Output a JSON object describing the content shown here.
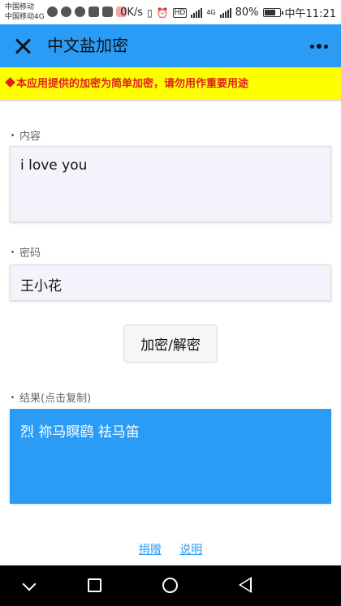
{
  "status_bar": {
    "carrier_1": "中国移动",
    "carrier_2": "中国移动4G",
    "speed": "0K/s",
    "hd_badge": "HD",
    "network_badge": "4G",
    "battery_percent": "80%",
    "battery_level": 0.8,
    "time": "中午11:21",
    "icons": [
      "wechat-icon",
      "app-icon",
      "chat-icon",
      "shield-icon",
      "calendar-icon",
      "notification-icon",
      "vibrate-icon",
      "alarm-icon",
      "signal-icon",
      "battery-icon"
    ]
  },
  "app_bar": {
    "title": "中文盐加密",
    "close_icon": "close-icon",
    "more_icon": "more-icon",
    "color": "#2b9cf5"
  },
  "warning": {
    "text": "本应用提供的加密为简单加密，请勿用作重要用途",
    "icon": "diamond-icon",
    "background": "#ffff00",
    "color": "#e02020"
  },
  "form": {
    "content_label": "内容",
    "content_value": "i love you",
    "password_label": "密码",
    "password_value": "王小花",
    "action_button": "加密/解密",
    "result_label": "结果(点击复制)",
    "result_value": "烈 祢马瞑鹞 祛马笛"
  },
  "footer": {
    "donate_link": "捐赠",
    "help_link": "说明"
  },
  "nav_bar": {
    "icons": [
      "nav-back-icon",
      "nav-recents-icon",
      "nav-home-icon",
      "nav-triangle-icon"
    ]
  }
}
